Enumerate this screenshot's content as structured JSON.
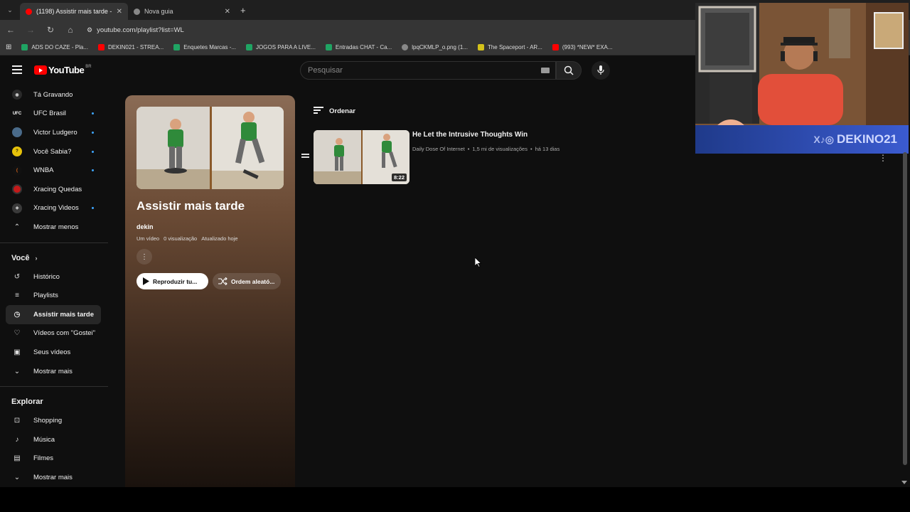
{
  "browser": {
    "tabs": [
      {
        "title": "(1198) Assistir mais tarde - You",
        "active": true
      },
      {
        "title": "Nova guia",
        "active": false
      }
    ],
    "url": "youtube.com/playlist?list=WL",
    "bookmarks": [
      "ADS DO CAZE - Pla...",
      "DEKIN021 - STREA...",
      "Enquetes Marcas -...",
      "JOGOS PARA A LIVE...",
      "Entradas CHAT - Ca...",
      "lpqCKMLP_o.png (1...",
      "The Spaceport - AR...",
      "(993) *NEW* EXA..."
    ]
  },
  "header": {
    "logo": "YouTube",
    "country": "BR",
    "search_placeholder": "Pesquisar"
  },
  "sidebar": {
    "subscriptions": [
      {
        "label": "Tá Gravando",
        "dot": false,
        "color": "#2a2a2a"
      },
      {
        "label": "UFC Brasil",
        "dot": true,
        "color": "#111111"
      },
      {
        "label": "Victor Ludgero",
        "dot": true,
        "color": "#4a6b8a"
      },
      {
        "label": "Você Sabia?",
        "dot": true,
        "color": "#e6c20a"
      },
      {
        "label": "WNBA",
        "dot": true,
        "color": "#111111"
      },
      {
        "label": "Xracing Quedas",
        "dot": false,
        "color": "#c41a1a"
      },
      {
        "label": "Xracing Videos",
        "dot": true,
        "color": "#3a3a3a"
      }
    ],
    "show_less": "Mostrar menos",
    "you_heading": "Você",
    "you_items": [
      {
        "label": "Histórico",
        "icon": "history-icon",
        "glyph": "↺"
      },
      {
        "label": "Playlists",
        "icon": "playlists-icon",
        "glyph": "≡"
      },
      {
        "label": "Assistir mais tarde",
        "icon": "watch-later-icon",
        "glyph": "◷",
        "selected": true
      },
      {
        "label": "Vídeos com \"Gostei\"",
        "icon": "like-icon",
        "glyph": "👍"
      },
      {
        "label": "Seus vídeos",
        "icon": "your-videos-icon",
        "glyph": "▶"
      }
    ],
    "show_more_1": "Mostrar mais",
    "explore_heading": "Explorar",
    "explore_items": [
      {
        "label": "Shopping",
        "icon": "shopping-icon",
        "glyph": "🛍"
      },
      {
        "label": "Música",
        "icon": "music-icon",
        "glyph": "♪"
      },
      {
        "label": "Filmes",
        "icon": "movies-icon",
        "glyph": "🎞"
      }
    ],
    "show_more_2": "Mostrar mais"
  },
  "playlist": {
    "title": "Assistir mais tarde",
    "owner": "dekin",
    "video_count": "Um vídeo",
    "views": "0 visualização",
    "updated": "Atualizado hoje",
    "play_all": "Reproduzir tu...",
    "shuffle": "Ordem aleató..."
  },
  "sort_label": "Ordenar",
  "video": {
    "title": "He Let the Intrusive Thoughts Win",
    "channel": "Daily Dose Of Internet",
    "views": "1,5 mi de visualizações",
    "age": "há 13 dias",
    "duration": "8:22"
  },
  "overlay": {
    "handle": "DEKINO21",
    "social": "X♪◎"
  }
}
